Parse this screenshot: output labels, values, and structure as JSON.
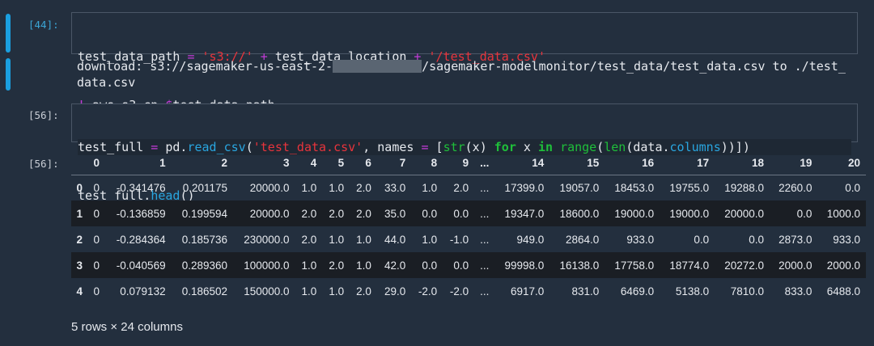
{
  "cells": {
    "cell1": {
      "prompt": "[44]:",
      "line1": {
        "var": "test_data_path",
        "eq": " = ",
        "s3": "'s3://'",
        "plus1": " + ",
        "loc": "test_data_location",
        "plus2": " + ",
        "file": "'/test_data.csv'"
      },
      "line2": {
        "bang": "!",
        "cmd": " aws s3 cp ",
        "dollar": "$",
        "arg": "test_data_path ."
      },
      "output": {
        "part1": "download: s3://sagemaker-us-east-2-",
        "part2": "/sagemaker-modelmonitor/test_data/test_data.csv to ./test_",
        "part3": "data.csv"
      }
    },
    "cell2": {
      "prompt": "[56]:",
      "line1": {
        "a": "test_full",
        "eq": " = ",
        "b": "pd.",
        "fn": "read_csv",
        "p1": "(",
        "str": "'test_data.csv'",
        "c": ", names ",
        "eq2": "=",
        "d": " [",
        "bi1": "str",
        "e": "(x) ",
        "kw1": "for",
        "f": " x ",
        "kw2": "in",
        "g": " ",
        "bi2": "range",
        "h": "(",
        "bi3": "len",
        "i": "(data.",
        "j": "columns",
        "k": "))])"
      },
      "line2": {
        "a": "test_full.",
        "fn": "head",
        "b": "()"
      },
      "out_prompt": "[56]:"
    }
  },
  "dataframe": {
    "columns": [
      "",
      "0",
      "1",
      "2",
      "3",
      "4",
      "5",
      "6",
      "7",
      "8",
      "9",
      "...",
      "14",
      "15",
      "16",
      "17",
      "18",
      "19",
      "20"
    ],
    "rows": [
      [
        "0",
        "0",
        "-0.341476",
        "0.201175",
        "20000.0",
        "1.0",
        "1.0",
        "2.0",
        "33.0",
        "1.0",
        "2.0",
        "...",
        "17399.0",
        "19057.0",
        "18453.0",
        "19755.0",
        "19288.0",
        "2260.0",
        "0.0"
      ],
      [
        "1",
        "0",
        "-0.136859",
        "0.199594",
        "20000.0",
        "2.0",
        "2.0",
        "2.0",
        "35.0",
        "0.0",
        "0.0",
        "...",
        "19347.0",
        "18600.0",
        "19000.0",
        "19000.0",
        "20000.0",
        "0.0",
        "1000.0"
      ],
      [
        "2",
        "0",
        "-0.284364",
        "0.185736",
        "230000.0",
        "2.0",
        "1.0",
        "1.0",
        "44.0",
        "1.0",
        "-1.0",
        "...",
        "949.0",
        "2864.0",
        "933.0",
        "0.0",
        "0.0",
        "2873.0",
        "933.0"
      ],
      [
        "3",
        "0",
        "-0.040569",
        "0.289360",
        "100000.0",
        "1.0",
        "2.0",
        "1.0",
        "42.0",
        "0.0",
        "0.0",
        "...",
        "99998.0",
        "16138.0",
        "17758.0",
        "18774.0",
        "20272.0",
        "2000.0",
        "2000.0"
      ],
      [
        "4",
        "0",
        "0.079132",
        "0.186502",
        "150000.0",
        "1.0",
        "1.0",
        "2.0",
        "29.0",
        "-2.0",
        "-2.0",
        "...",
        "6917.0",
        "831.0",
        "6469.0",
        "5138.0",
        "7810.0",
        "833.0",
        "6488.0"
      ]
    ],
    "caption": "5 rows × 24 columns"
  }
}
